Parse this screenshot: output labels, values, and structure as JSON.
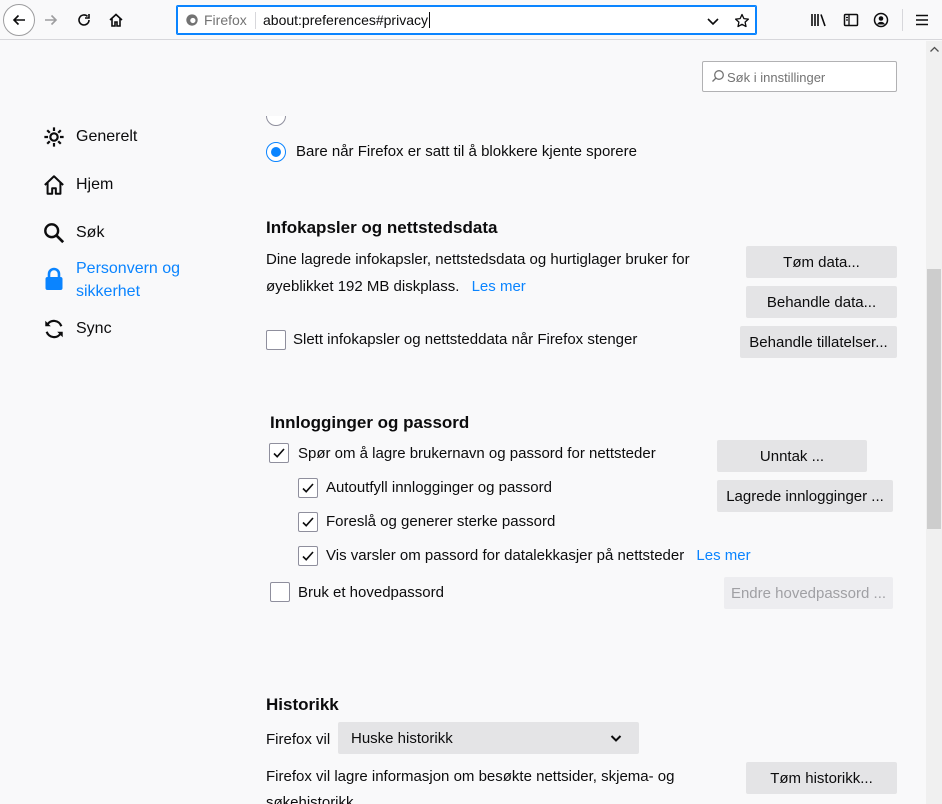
{
  "toolbar": {
    "identity_label": "Firefox",
    "url": "about:preferences#privacy"
  },
  "search": {
    "placeholder": "Søk i innstillinger"
  },
  "categories": [
    {
      "label": "Generelt",
      "icon": "gear-icon"
    },
    {
      "label": "Hjem",
      "icon": "home-icon"
    },
    {
      "label": "Søk",
      "icon": "search-icon"
    },
    {
      "label": "Personvern og sikkerhet",
      "icon": "lock-icon",
      "active": true
    },
    {
      "label": "Sync",
      "icon": "sync-icon"
    }
  ],
  "tracking": {
    "radio_label": "Bare når Firefox er satt til å blokkere kjente sporere",
    "selected": true
  },
  "cookies": {
    "heading": "Infokapsler og nettstedsdata",
    "desc_line1": "Dine lagrede infokapsler, nettstedsdata og hurtiglager bruker for",
    "desc_line2": "øyeblikket 192 MB diskplass.",
    "learn_more": "Les mer",
    "clear_button": "Tøm data...",
    "manage_button": "Behandle data...",
    "permissions_button": "Behandle tillatelser...",
    "delete_on_close_label": "Slett infokapsler og nettsteddata når Firefox stenger",
    "delete_on_close_checked": false
  },
  "logins": {
    "heading": "Innlogginger og passord",
    "ask_save_label": "Spør om å lagre brukernavn og passord for nettsteder",
    "ask_save_checked": true,
    "autofill_label": "Autoutfyll innlogginger og passord",
    "autofill_checked": true,
    "suggest_label": "Foreslå og generer sterke passord",
    "suggest_checked": true,
    "breach_label": "Vis varsler om passord for datalekkasjer på nettsteder",
    "breach_checked": true,
    "breach_learn_more": "Les mer",
    "exceptions_button": "Unntak ...",
    "saved_logins_button": "Lagrede innlogginger ...",
    "master_password_label": "Bruk et hovedpassord",
    "master_password_checked": false,
    "change_master_button": "Endre hovedpassord ..."
  },
  "history": {
    "heading": "Historikk",
    "firefox_will_label": "Firefox vil",
    "mode_value": "Huske historikk",
    "desc_line1": "Firefox vil lagre informasjon om besøkte nettsider, skjema- og",
    "desc_line2": "søkehistorikk",
    "clear_button": "Tøm historikk..."
  },
  "colors": {
    "accent": "#0a84ff",
    "button_bg": "#e4e4e6",
    "page_bg": "#f9f9fa"
  }
}
